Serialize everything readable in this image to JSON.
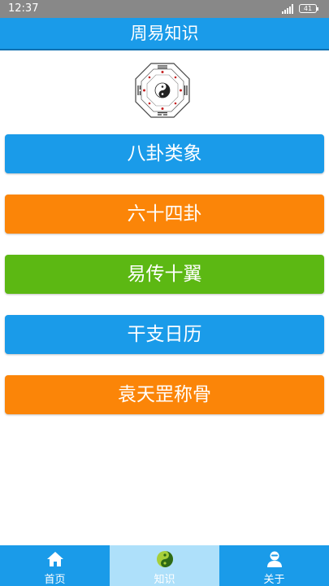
{
  "status_bar": {
    "time": "12:37",
    "battery": "41"
  },
  "header": {
    "title": "周易知识"
  },
  "menu": [
    {
      "label": "八卦类象",
      "color": "#1a9be9"
    },
    {
      "label": "六十四卦",
      "color": "#fb8508"
    },
    {
      "label": "易传十翼",
      "color": "#5cb813"
    },
    {
      "label": "干支日历",
      "color": "#1a9be9"
    },
    {
      "label": "袁天罡称骨",
      "color": "#fb8508"
    }
  ],
  "bottom_nav": [
    {
      "label": "首页",
      "icon": "home-icon"
    },
    {
      "label": "知识",
      "icon": "yin-yang-icon",
      "active": true
    },
    {
      "label": "关于",
      "icon": "person-icon"
    }
  ],
  "colors": {
    "header": "#1a9be9",
    "nav_active": "#aee0fa"
  }
}
